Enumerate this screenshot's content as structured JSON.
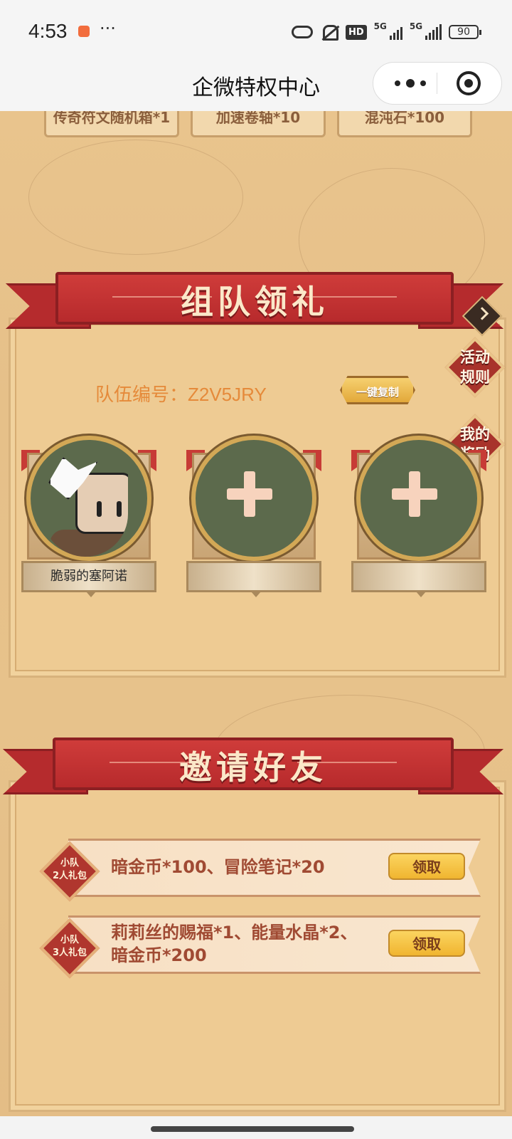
{
  "status_bar": {
    "time": "4:53",
    "battery": "90",
    "network": "5G",
    "hd": "HD"
  },
  "nav": {
    "title": "企微特权中心"
  },
  "prev_rewards": [
    "传奇符文随机箱*1",
    "加速卷轴*10",
    "混沌石*100"
  ],
  "team": {
    "banner": "组队领礼",
    "team_id_label": "队伍编号：Z2V5JRY",
    "copy_button": "一键复制",
    "side_rules": "活动\n规则",
    "side_rewards": "我的\n奖励",
    "members": [
      {
        "name": "脆弱的塞阿诺"
      },
      {
        "name": ""
      },
      {
        "name": ""
      }
    ]
  },
  "invite": {
    "banner": "邀请好友",
    "rows": [
      {
        "badge": "小队\n2人礼包",
        "reward": "暗金币*100、冒险笔记*20",
        "button": "领取"
      },
      {
        "badge": "小队\n3人礼包",
        "reward": "莉莉丝的赐福*1、能量水晶*2、\n暗金币*200",
        "button": "领取"
      }
    ]
  },
  "colors": {
    "accent_red": "#b72a2c",
    "parchment": "#eecb93",
    "claim_gold": "#f0b530"
  }
}
